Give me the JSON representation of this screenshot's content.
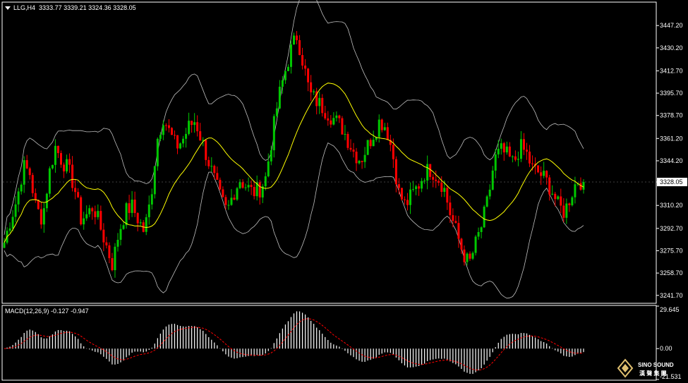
{
  "header": {
    "symbol": "LLG,H4",
    "ohlc": "3333.77 3339.21 3324.36 3328.05"
  },
  "macd_header": {
    "label": "MACD(12,26,9)",
    "values": "-0.127 -0.947"
  },
  "logo": {
    "name": "SINO SOUND",
    "subtitle": "漢 聲 集 團"
  },
  "colors": {
    "bull": "#00c800",
    "bear": "#ff0000",
    "ma": "#ffff00",
    "bands": "#c0c0c0",
    "macd_signal": "#ff0000",
    "macd_hist": "#ffffff",
    "current_price_box": "#ffffff",
    "grid_border": "#ffffff"
  },
  "chart_data": [
    {
      "type": "candlestick",
      "title": "LLG,H4",
      "current_price": 3328.05,
      "ylim": [
        3236.2,
        3464.5
      ],
      "yticks": [
        "3447.20",
        "3430.20",
        "3412.70",
        "3395.70",
        "3378.70",
        "3361.20",
        "3344.20",
        "3328.05",
        "3310.20",
        "3292.70",
        "3275.70",
        "3258.70",
        "3241.70"
      ],
      "ytick_values": [
        3447.2,
        3430.2,
        3412.7,
        3395.7,
        3378.7,
        3361.2,
        3344.2,
        3328.05,
        3310.2,
        3292.7,
        3275.7,
        3258.7,
        3241.7
      ],
      "overlays": [
        "moving average (yellow)",
        "Bollinger bands (grey)"
      ],
      "approx_close_path": [
        3282,
        3300,
        3315,
        3340,
        3335,
        3308,
        3300,
        3333,
        3355,
        3345,
        3338,
        3325,
        3300,
        3303,
        3310,
        3295,
        3280,
        3265,
        3290,
        3305,
        3310,
        3300,
        3290,
        3315,
        3360,
        3378,
        3365,
        3355,
        3360,
        3370,
        3375,
        3360,
        3345,
        3330,
        3315,
        3305,
        3320,
        3330,
        3325,
        3320,
        3322,
        3330,
        3360,
        3390,
        3410,
        3428,
        3440,
        3418,
        3395,
        3390,
        3385,
        3380,
        3375,
        3370,
        3360,
        3350,
        3345,
        3355,
        3365,
        3375,
        3370,
        3350,
        3320,
        3310,
        3318,
        3325,
        3335,
        3338,
        3332,
        3325,
        3305,
        3290,
        3275,
        3265,
        3280,
        3295,
        3315,
        3345,
        3352,
        3348,
        3342,
        3355,
        3350,
        3338,
        3335,
        3330,
        3322,
        3310,
        3305,
        3318,
        3330,
        3328.05
      ]
    },
    {
      "type": "bar",
      "title": "MACD(12,26,9)",
      "ylim": [
        -21.531,
        29.645
      ],
      "yticks": [
        "29.645",
        "0.00",
        "-21.531"
      ],
      "ytick_values": [
        29.645,
        0.0,
        -21.531
      ],
      "series": [
        {
          "name": "MACD",
          "kind": "histogram",
          "last": -0.127
        },
        {
          "name": "Signal",
          "kind": "line",
          "last": -0.947
        }
      ]
    }
  ]
}
